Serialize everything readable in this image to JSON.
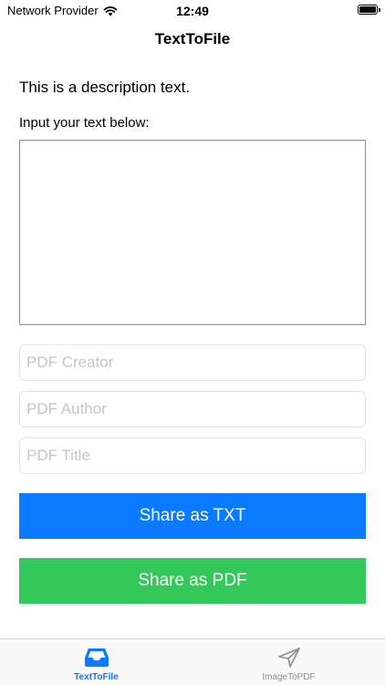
{
  "status_bar": {
    "carrier": "Network Provider",
    "time": "12:49",
    "wifi_icon": "wifi-icon",
    "battery_icon": "battery-icon",
    "battery_level": 1.0
  },
  "nav": {
    "title": "TextToFile"
  },
  "content": {
    "description": "This is a description text.",
    "input_label": "Input your text below:",
    "text_value": "",
    "fields": {
      "creator_placeholder": "PDF Creator",
      "author_placeholder": "PDF Author",
      "title_placeholder": "PDF Title"
    },
    "buttons": {
      "share_txt": "Share as TXT",
      "share_pdf": "Share as PDF"
    }
  },
  "tab_bar": {
    "tabs": [
      {
        "label": "TextToFile",
        "icon": "inbox-tray-icon",
        "selected": true
      },
      {
        "label": "ImageToPDF",
        "icon": "paper-plane-icon",
        "selected": false
      }
    ]
  },
  "colors": {
    "accent_blue": "#0a7aff",
    "accent_green": "#34c759",
    "tab_inactive": "#8e8e93",
    "placeholder": "#c4c4c6",
    "field_border": "#e3e3e6"
  }
}
